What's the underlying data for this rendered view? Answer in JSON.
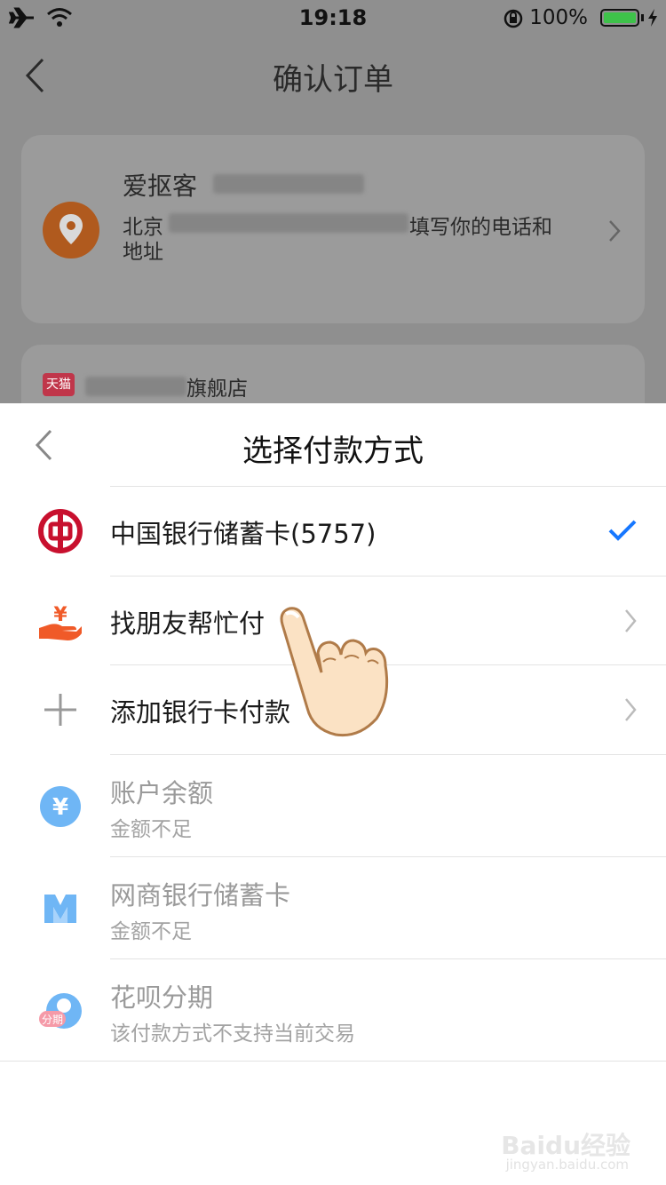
{
  "status_bar": {
    "time": "19:18",
    "battery": "100%",
    "icons": [
      "airplane-icon",
      "wifi-icon",
      "orientation-lock-icon",
      "battery-icon",
      "charging-icon"
    ]
  },
  "background_page": {
    "title": "确认订单",
    "address": {
      "name": "爱抠客",
      "line1_prefix": "北京",
      "line1_suffix": "填写你的电话和",
      "line2": "地址"
    },
    "shop": {
      "badge": "天猫",
      "name_suffix": "旗舰店"
    }
  },
  "sheet": {
    "title": "选择付款方式",
    "methods": [
      {
        "label": "中国银行储蓄卡(5757)",
        "selected": true,
        "icon": "boc-bank-icon"
      },
      {
        "label": "找朋友帮忙付",
        "icon": "friend-pay-icon"
      },
      {
        "label": "添加银行卡付款",
        "icon": "plus-icon"
      },
      {
        "label": "账户余额",
        "sub": "金额不足",
        "icon": "yuan-balance-icon"
      },
      {
        "label": "网商银行储蓄卡",
        "sub": "金额不足",
        "icon": "mybank-icon"
      },
      {
        "label": "花呗分期",
        "sub": "该付款方式不支持当前交易",
        "icon": "huabei-icon",
        "icon_text": "分期"
      }
    ]
  },
  "watermark": {
    "brand": "Baidu经验",
    "url": "jingyan.baidu.com"
  },
  "colors": {
    "accent": "#1677ff",
    "boc_red": "#c8102e",
    "friend_orange": "#f05a28",
    "balance_blue": "#5aa9f5"
  }
}
